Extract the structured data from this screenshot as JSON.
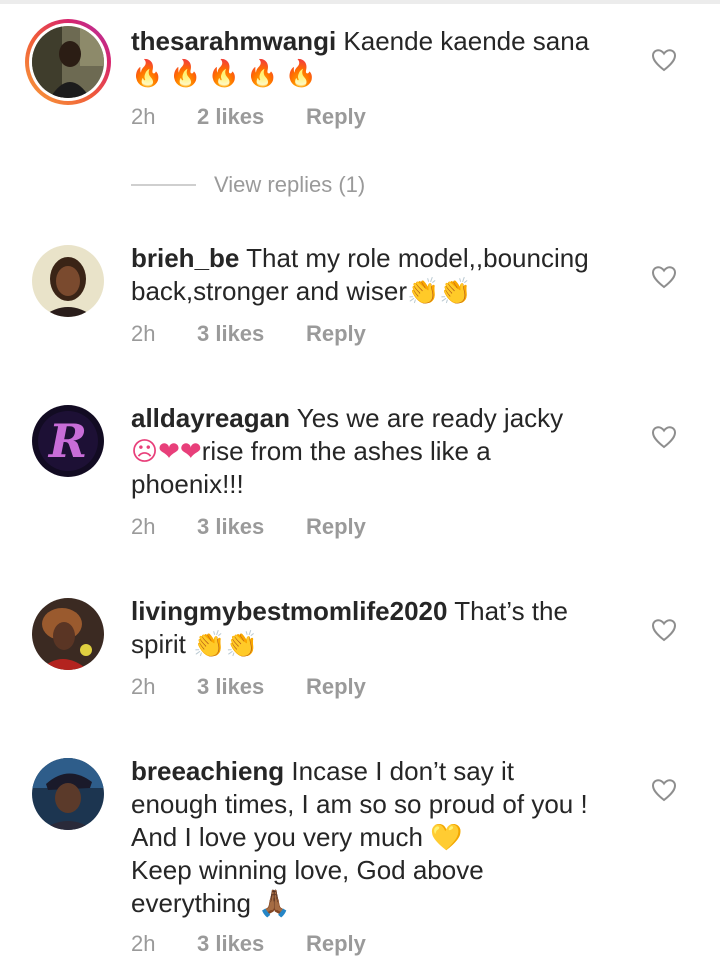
{
  "comments": [
    {
      "username": "thesarahmwangi",
      "text": "Kaende kaende sana",
      "emoji": "🔥🔥🔥🔥🔥",
      "time": "2h",
      "likes": "2 likes",
      "reply": "Reply",
      "view_replies": "View replies (1)",
      "avatar": "woman-portrait-avatar"
    },
    {
      "username": "brieh_be",
      "text": "That my role model,,bouncing back,stronger and wiser",
      "emoji": "👏👏",
      "time": "2h",
      "likes": "3 likes",
      "reply": "Reply",
      "avatar": "woman-selfie-avatar"
    },
    {
      "username": "alldayreagan",
      "text_line1": "Yes we are ready jacky",
      "emoji": "☹❤❤",
      "text_line2": "rise from the ashes like a",
      "text_line3": "phoenix!!!",
      "time": "2h",
      "likes": "3 likes",
      "reply": "Reply",
      "avatar": "letter-r-logo-avatar"
    },
    {
      "username": "livingmybestmomlife2020",
      "text_line1": "That’s the",
      "text_line2": "spirit 👏👏",
      "time": "2h",
      "likes": "3 likes",
      "reply": "Reply",
      "avatar": "woman-braids-avatar"
    },
    {
      "username": "breeachieng",
      "text_line1": "Incase I don’t say it",
      "text_line2": "enough times, I am so so proud of you !",
      "text_line3": "And I love you very much",
      "emoji_heart": "💛",
      "text_line4": "Keep winning love, God above",
      "text_line5": "everything",
      "emoji_pray": "🙏🏾",
      "time": "2h",
      "likes": "3 likes",
      "reply": "Reply",
      "avatar": "person-cap-avatar"
    }
  ],
  "colors": {
    "text": "#262626",
    "meta": "#9a9a9a",
    "story_ring": [
      "#f9a13a",
      "#d6246e",
      "#a43ab4"
    ]
  },
  "icons": {
    "like": "heart-outline-icon"
  }
}
